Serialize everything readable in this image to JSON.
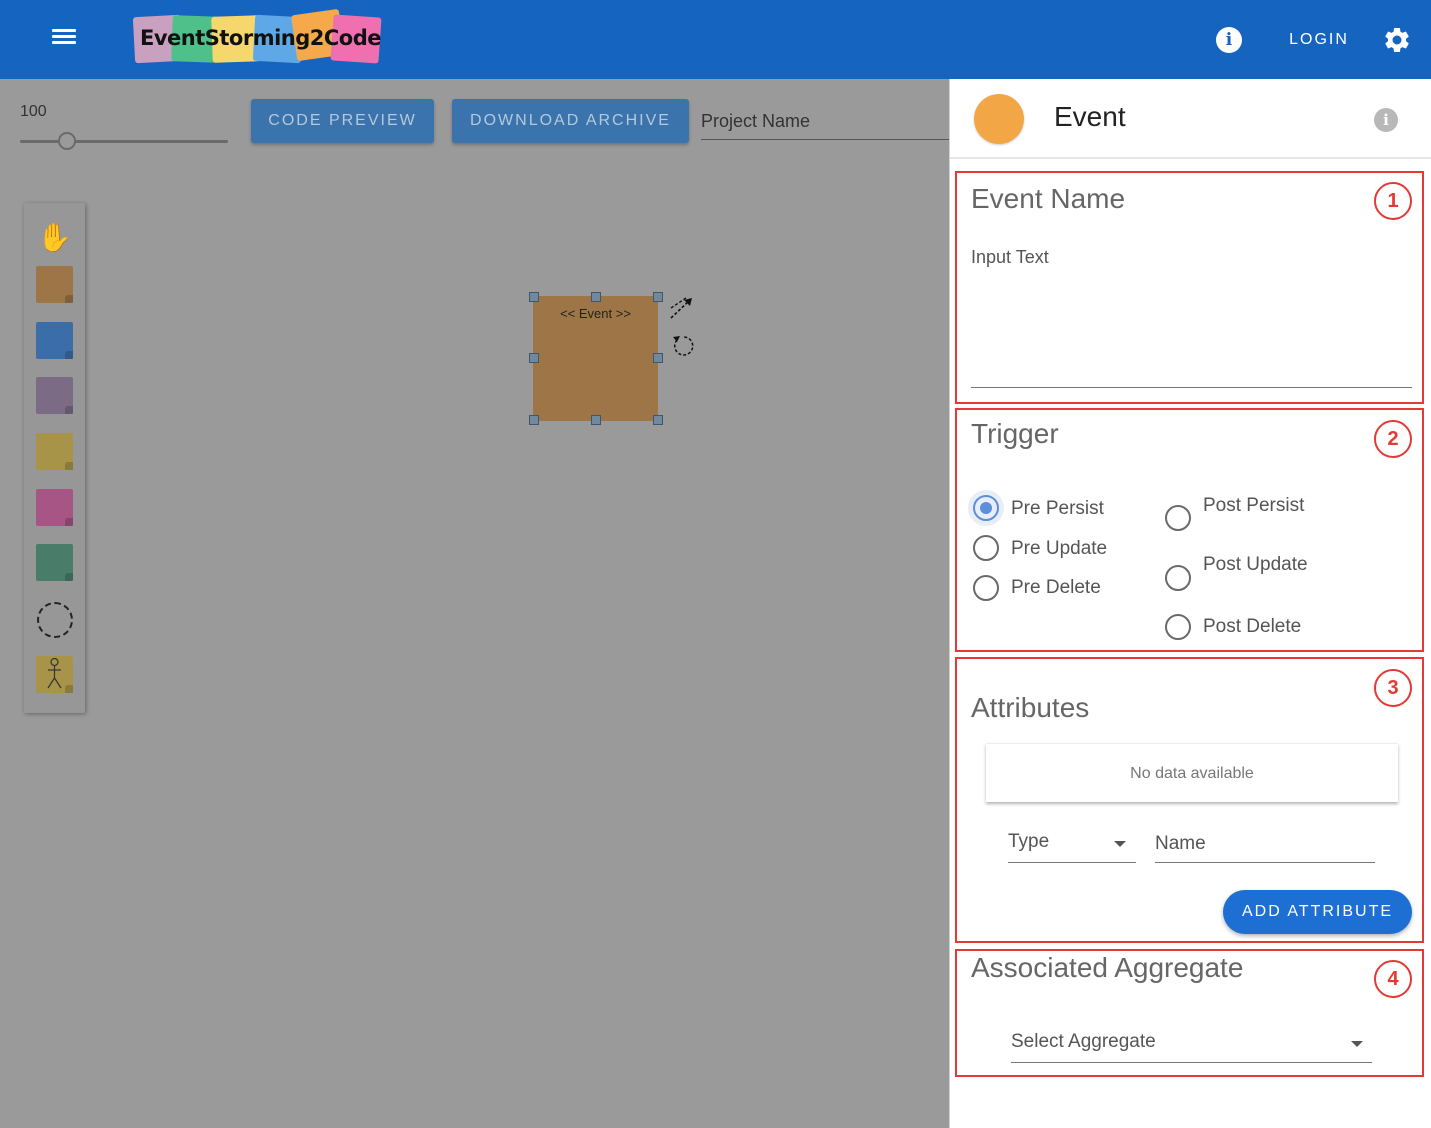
{
  "app": {
    "logo_text": "EventStorming2Code",
    "login_label": "LOGIN",
    "logo_colors": [
      "#c9a0c0",
      "#4fc08a",
      "#f5d76e",
      "#5fa8e8",
      "#f5a94a",
      "#ef6fb0"
    ]
  },
  "toolbar": {
    "zoom_value": "100",
    "zoom_level": 100,
    "code_preview_label": "CODE PREVIEW",
    "download_archive_label": "DOWNLOAD ARCHIVE",
    "project_name_placeholder": "Project Name"
  },
  "palette": {
    "items": [
      {
        "name": "hand-tool-icon"
      },
      {
        "name": "event-sticky",
        "color": "#9e7547"
      },
      {
        "name": "command-sticky",
        "color": "#3b6ea8"
      },
      {
        "name": "policy-sticky",
        "color": "#7c6b85"
      },
      {
        "name": "aggregate-sticky",
        "color": "#a89448"
      },
      {
        "name": "external-system-sticky",
        "color": "#a65584"
      },
      {
        "name": "read-model-sticky",
        "color": "#4a7d69"
      },
      {
        "name": "bounded-context-icon"
      },
      {
        "name": "actor-sticky",
        "color": "#a89448"
      }
    ]
  },
  "canvas": {
    "sticky_label": "<< Event >>",
    "sticky_color": "#9e7547"
  },
  "panel": {
    "title": "Event",
    "accent_color": "#f2a645",
    "sections": {
      "event_name": {
        "badge": "1",
        "title": "Event Name",
        "input_label": "Input Text"
      },
      "trigger": {
        "badge": "2",
        "title": "Trigger",
        "options_left": [
          "Pre Persist",
          "Pre Update",
          "Pre Delete"
        ],
        "options_right": [
          "Post Persist",
          "Post Update",
          "Post Delete"
        ],
        "selected": "Pre Persist"
      },
      "attributes": {
        "badge": "3",
        "title": "Attributes",
        "empty_text": "No data available",
        "type_label": "Type",
        "name_placeholder": "Name",
        "add_label": "ADD ATTRIBUTE"
      },
      "aggregate": {
        "badge": "4",
        "title": "Associated Aggregate",
        "select_label": "Select Aggregate"
      }
    }
  }
}
